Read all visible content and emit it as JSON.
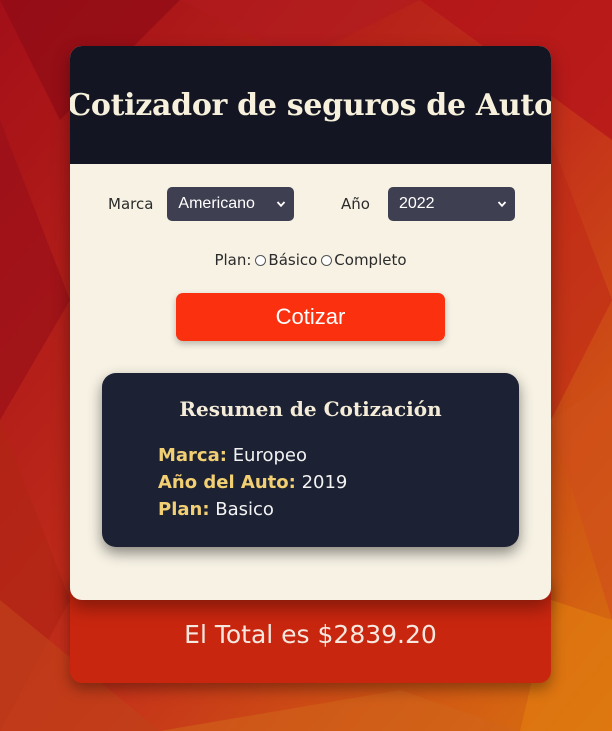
{
  "header": {
    "title": "Cotizador de seguros de Auto"
  },
  "form": {
    "marca_label": "Marca",
    "marca_value": "Americano",
    "anio_label": "Año",
    "anio_value": "2022",
    "plan_label": "Plan:",
    "plan_options": [
      "Básico",
      "Completo"
    ],
    "submit_label": "Cotizar"
  },
  "summary": {
    "title": "Resumen de Cotización",
    "marca_key": "Marca:",
    "marca_value": "Europeo",
    "anio_key": "Año del Auto:",
    "anio_value": "2019",
    "plan_key": "Plan:",
    "plan_value": "Basico"
  },
  "total": {
    "text": "El Total es $2839.20"
  },
  "colors": {
    "header_bg": "#131622",
    "card_bg": "#f7f2e4",
    "button_bg": "#fb300f",
    "summary_bg": "#1c2233",
    "summary_key": "#f2cf73",
    "total_bg": "#c9260f"
  }
}
